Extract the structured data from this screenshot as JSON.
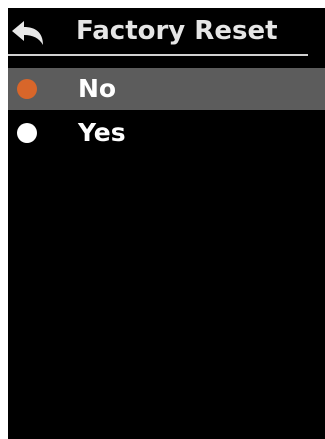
{
  "header": {
    "title": "Factory Reset",
    "back_icon": "back-arrow-icon"
  },
  "options": [
    {
      "label": "No",
      "selected": true,
      "indicator_color": "#d8662a"
    },
    {
      "label": "Yes",
      "selected": false,
      "indicator_color": "#ffffff"
    }
  ],
  "colors": {
    "background": "#000000",
    "selected_row": "#5c5c5c",
    "text": "#ffffff",
    "accent": "#d8662a"
  }
}
